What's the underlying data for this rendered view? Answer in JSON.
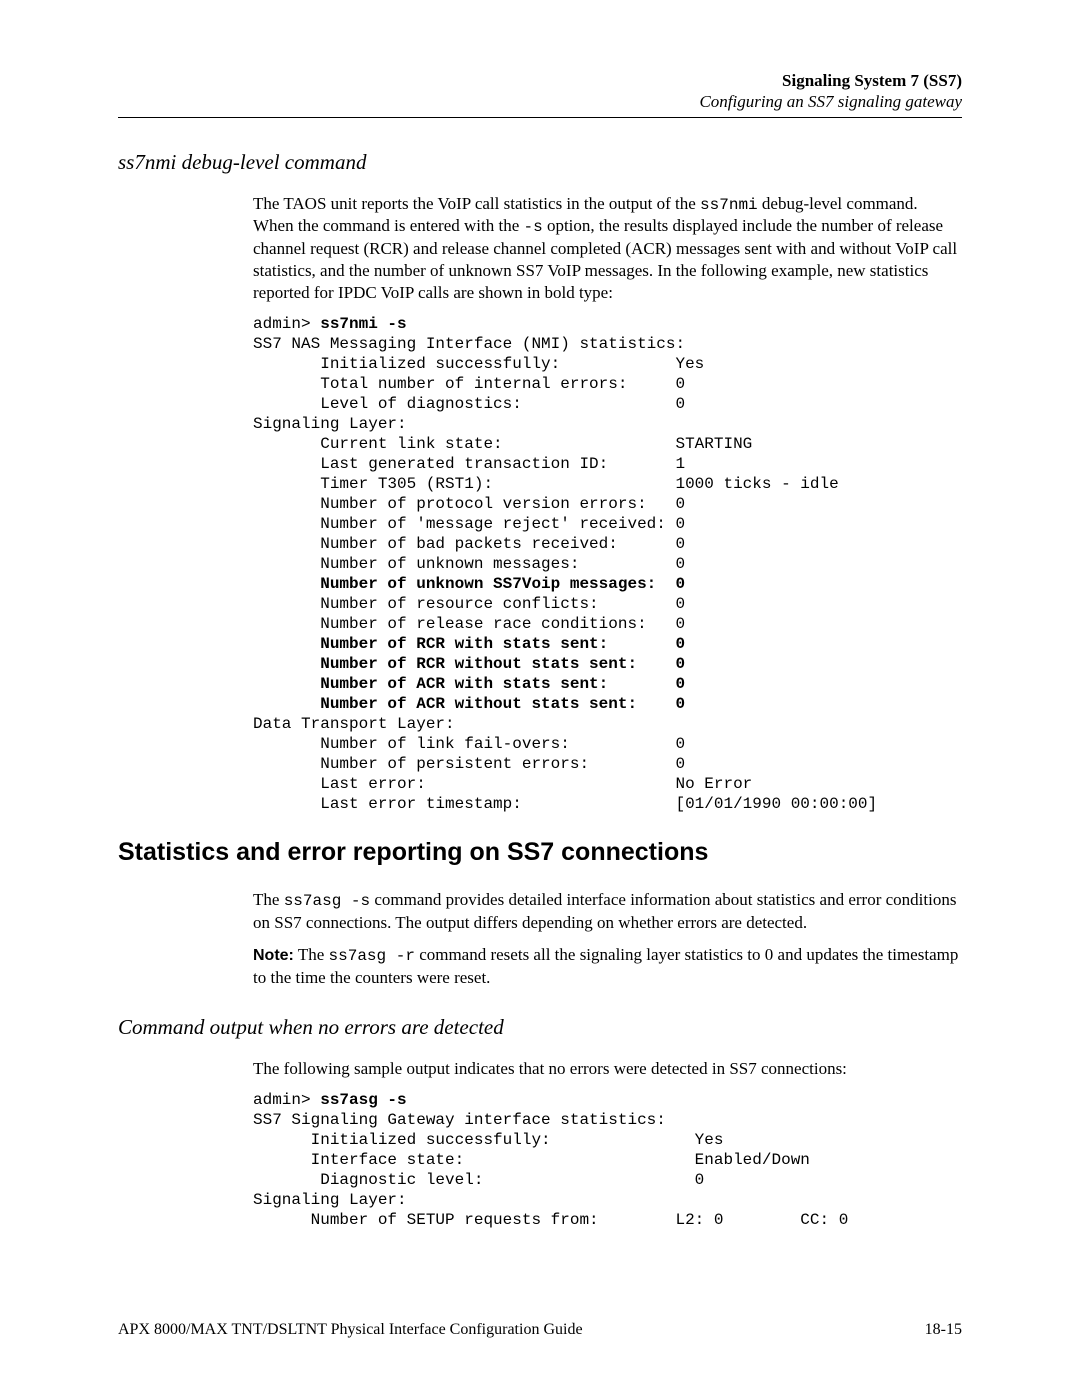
{
  "header": {
    "title_bold": "Signaling System 7 (SS7)",
    "title_italic": "Configuring an SS7 signaling gateway"
  },
  "section1": {
    "heading": "ss7nmi debug-level command",
    "para_parts": {
      "p1": "The TAOS unit reports the VoIP call statistics in the output of the ",
      "code1": "ss7nmi",
      "p2": " debug-level command. When the command is entered with the ",
      "code2": "-s",
      "p3": " option, the results displayed include the number of release channel request (RCR) and release channel completed (ACR) messages sent with and without VoIP call statistics, and the number of unknown SS7 VoIP messages. In the following example, new statistics reported for IPDC VoIP calls are shown in bold type:"
    },
    "cmd_prompt": "admin> ",
    "cmd": "ss7nmi -s",
    "out_header": "SS7 NAS Messaging Interface (NMI) statistics:",
    "rows": [
      {
        "k": "Initialized successfully:",
        "v": "Yes",
        "bold": false
      },
      {
        "k": "Total number of internal errors:",
        "v": "0",
        "bold": false
      },
      {
        "k": "Level of diagnostics:",
        "v": "0",
        "bold": false
      }
    ],
    "sig_layer_label": "Signaling Layer:",
    "sig_rows": [
      {
        "k": "Current link state:",
        "v": "STARTING",
        "bold": false
      },
      {
        "k": "Last generated transaction ID:",
        "v": "1",
        "bold": false
      },
      {
        "k": "Timer T305 (RST1):",
        "v": "1000 ticks - idle",
        "bold": false
      },
      {
        "k": "Number of protocol version errors:",
        "v": "0",
        "bold": false
      },
      {
        "k": "Number of 'message reject' received:",
        "v": "0",
        "bold": false
      },
      {
        "k": "Number of bad packets received:",
        "v": "0",
        "bold": false
      },
      {
        "k": "Number of unknown messages:",
        "v": "0",
        "bold": false
      },
      {
        "k": "Number of unknown SS7Voip messages:",
        "v": "0",
        "bold": true
      },
      {
        "k": "Number of resource conflicts:",
        "v": "0",
        "bold": false
      },
      {
        "k": "Number of release race conditions:",
        "v": "0",
        "bold": false
      },
      {
        "k": "Number of RCR with stats sent:",
        "v": "0",
        "bold": true
      },
      {
        "k": "Number of RCR without stats sent:",
        "v": "0",
        "bold": true
      },
      {
        "k": "Number of ACR with stats sent:",
        "v": "0",
        "bold": true
      },
      {
        "k": "Number of ACR without stats sent:",
        "v": "0",
        "bold": true
      }
    ],
    "data_layer_label": "Data Transport Layer:",
    "data_rows": [
      {
        "k": "Number of link fail-overs:",
        "v": "0",
        "bold": false
      },
      {
        "k": "Number of persistent errors:",
        "v": "0",
        "bold": false
      },
      {
        "k": "Last error:",
        "v": "No Error",
        "bold": false
      },
      {
        "k": "Last error timestamp:",
        "v": "[01/01/1990 00:00:00]",
        "bold": false
      }
    ]
  },
  "section2": {
    "heading": "Statistics and error reporting on SS7 connections",
    "para1_parts": {
      "p1": "The ",
      "code1": "ss7asg -s",
      "p2": " command provides detailed interface information about statistics and error conditions on SS7 connections. The output differs depending on whether errors are detected."
    },
    "note_label": "Note:",
    "note_parts": {
      "p1": "  The ",
      "code1": "ss7asg -r",
      "p2": " command resets all the signaling layer statistics to 0 and updates the timestamp to the time the counters were reset."
    }
  },
  "section3": {
    "heading": "Command output when no errors are detected",
    "para": "The following sample output indicates that no errors were detected in SS7 connections:",
    "cmd_prompt": "admin> ",
    "cmd": "ss7asg -s",
    "out_header": "SS7 Signaling Gateway interface statistics:",
    "rows": [
      {
        "k": "Initialized successfully:",
        "v": "Yes"
      },
      {
        "k": "Interface state:",
        "v": "Enabled/Down"
      },
      {
        "k": " Diagnostic level:",
        "v": "0"
      }
    ],
    "sig_layer_label": "Signaling Layer:",
    "sig_row_k": "Number of SETUP requests from:",
    "sig_row_v1": "L2: 0",
    "sig_row_v2": "CC: 0"
  },
  "footer": {
    "left": "APX 8000/MAX TNT/DSLTNT Physical Interface Configuration Guide",
    "right": "18-15"
  }
}
